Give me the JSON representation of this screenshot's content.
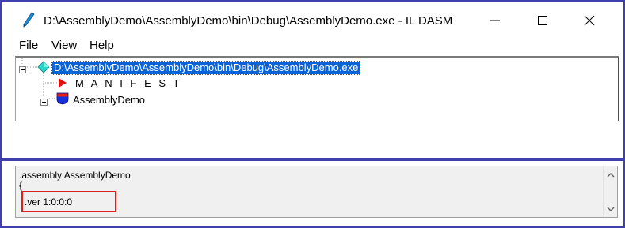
{
  "window": {
    "title": "D:\\AssemblyDemo\\AssemblyDemo\\bin\\Debug\\AssemblyDemo.exe - IL DASM",
    "app_icon": "pen-icon",
    "controls": [
      "minimize-icon",
      "maximize-icon",
      "close-icon"
    ]
  },
  "menubar": {
    "items": [
      {
        "label": "File"
      },
      {
        "label": "View"
      },
      {
        "label": "Help"
      }
    ]
  },
  "tree": {
    "root": {
      "label": "D:\\AssemblyDemo\\AssemblyDemo\\bin\\Debug\\AssemblyDemo.exe",
      "icon": "diamond-icon",
      "expanded": true,
      "selected": true
    },
    "children": [
      {
        "label": "M A N I F E S T",
        "icon": "triangle-right-icon"
      },
      {
        "label": "AssemblyDemo",
        "icon": "shield-icon",
        "expandable": true
      }
    ]
  },
  "detail": {
    "lines": [
      ".assembly AssemblyDemo",
      "{",
      ".ver 1:0:0:0"
    ],
    "highlight_color": "#e0201e"
  },
  "colors": {
    "selection": "#0a64d8",
    "frame_border": "#3f3fae",
    "manifest_icon": "#e01010",
    "shield_icon": "#1a2fd8",
    "diamond_icon": "#2bd4c8"
  }
}
